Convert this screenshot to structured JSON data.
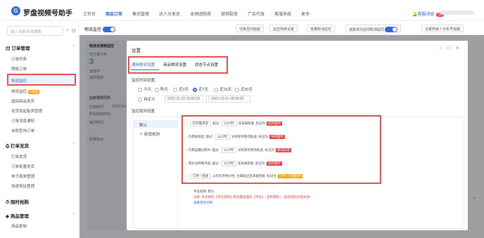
{
  "header": {
    "logo_glyph": "G",
    "app_title": "罗盘视频号助手",
    "nav": [
      "工作台",
      "商品订单",
      "售后管理",
      "达人分享员",
      "本地团购券",
      "营销裂变",
      "广告代发",
      "客服系统",
      "更多"
    ],
    "nav_active": 1,
    "messages_label": "客服消息",
    "messages_count": "16"
  },
  "sidebar": {
    "search_placeholder": "输入功能名称搜索",
    "groups": [
      {
        "label": "订单管理",
        "items": [
          "订单列表",
          "预售订单",
          "物流监控",
          "物流监控",
          "虚拟商品发货",
          "发货发起售卖管理",
          "订单消息通知",
          "自助查询订单"
        ]
      },
      {
        "label": "打单发货",
        "items": [
          "打单发货",
          "订单批量发货",
          "电子面单管理",
          "快递地址管理"
        ]
      },
      {
        "label": "限时抢购",
        "items": []
      },
      {
        "label": "商品管理",
        "items": [
          "商品复制"
        ]
      }
    ],
    "selected_item": "物流监控",
    "new_tag": "再新版"
  },
  "toolbar": {
    "label": "物流监控",
    "buttons": [
      "切换至旧版面",
      "监控突破设置",
      "批量取消监控",
      "退款成功自动取消监控",
      "设置商家人手机号提醒"
    ]
  },
  "background": {
    "card_title": "物流全链路监控",
    "count_label": "已打单今日",
    "count": "3",
    "lines": [
      "运送中",
      "运单揽收",
      "运单管理列表",
      "打单时间",
      "2025-04-01",
      "原始揽收时间",
      "操作时间",
      "异常标记"
    ]
  },
  "dialog": {
    "title": "设置",
    "tabs": [
      "通用物流设置",
      "商品物流设置",
      "状态节点设置"
    ],
    "active_tab": 0,
    "monitor_range_label": "监控时间设置",
    "radios": [
      "今天",
      "昨天",
      "近3天",
      "近7天",
      "近15天",
      "近30天"
    ],
    "radio_selected": 3,
    "custom_label": "自定义",
    "date_start": "2022-11-22 15:50:33",
    "date_end": "2022-12-01 00:00:02",
    "rules_label": "监控规则设置",
    "rule_groups": [
      "默认",
      "新增规则"
    ],
    "rules": [
      {
        "a": "打印面单后",
        "b": "超过",
        "c": "12小时",
        "d": "还未被揽收, 标记为",
        "tag": "揽件超时",
        "color": "#e14040"
      },
      {
        "a": "包裹揽收后, 超过",
        "b": "",
        "c": "12小时",
        "d": "没有新的物流轨迹, 标记为",
        "tag": "中转超时",
        "color": "#e14040"
      },
      {
        "a": "包裹运输过程中, 超过",
        "b": "",
        "c": "12小时",
        "d": "没有新的物流轨迹, 标记为",
        "tag": "物流异常",
        "color": "#e14040"
      },
      {
        "a": "到达派件网点后, 超过",
        "b": "",
        "c": "12小时",
        "d": "还未被签收, 标记为",
        "tag": "派件超时",
        "color": "#e14040"
      },
      {
        "a": "订单一签收",
        "b": "",
        "c": "从打印开始计时, 仓库超过",
        "d": "还未被签收, 标记为",
        "tag": "订单一签收超时",
        "color": "#ffa000"
      }
    ],
    "footer_platform": "平台名称: 默认",
    "footer_note": "注意: 此功能的【平台名称】和设置里面的【平台】, 名称需统一, 监控规则才能生效!",
    "footer_link": "查看更新说明"
  }
}
